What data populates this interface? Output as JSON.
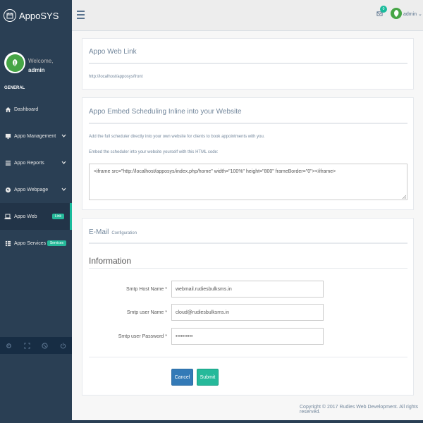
{
  "brand": {
    "name": "AppoSYS",
    "icon": "calendar-icon"
  },
  "profile": {
    "welcome": "Welcome,",
    "username": "admin"
  },
  "sidebar": {
    "section_title": "GENERAL",
    "items": [
      {
        "label": "Dashboard",
        "icon": "home-icon"
      },
      {
        "label": "Appo Management",
        "icon": "desktop-icon",
        "chevron": "⌄"
      },
      {
        "label": "Appo Reports",
        "icon": "list-icon",
        "chevron": "⌄"
      },
      {
        "label": "Appo Webpage",
        "icon": "globe-icon",
        "chevron": "⌄"
      },
      {
        "label": "Appo Web",
        "icon": "laptop-icon",
        "tag": "Link"
      },
      {
        "label": "Appo Services",
        "icon": "table-icon",
        "tag": "Services"
      }
    ],
    "footer_icons": [
      "settings-icon",
      "fullscreen-icon",
      "lock-icon",
      "logout-icon"
    ]
  },
  "topnav": {
    "mail_count": "0",
    "user": "admin"
  },
  "web_link": {
    "title": "Appo Web Link",
    "url": "http://localhost/apposys/front"
  },
  "embed": {
    "title": "Appo Embed Scheduling Inline into your Website",
    "desc1": "Add the full scheduler directly into your own website for clients to book appointments with you.",
    "desc2": "Embed the scheduler into your website yourself with this HTML code:",
    "code": "<iframe src=\"http://localhost/apposys/index.php/home\" width=\"100%\" height=\"800\" frameBorder=\"0\"></iframe>"
  },
  "email": {
    "title": "E-Mail",
    "subtitle": "Configuration",
    "heading": "Information",
    "fields": [
      {
        "label": "Smtp Host Name *",
        "value": "webmail.rudiesbulksms.in"
      },
      {
        "label": "Smtp user Name *",
        "value": "cloud@rudiesbulksms.in"
      },
      {
        "label": "Smtp user Password *",
        "value": "••••••••••"
      }
    ],
    "cancel_label": "Cancel",
    "submit_label": "Submit"
  },
  "footer": {
    "text": "Copyright © 2017 Rudies Web Development. All rights reserved."
  },
  "colors": {
    "sidebar": "#2a3f54",
    "accent": "#1abb9c",
    "primary": "#337ab7"
  }
}
